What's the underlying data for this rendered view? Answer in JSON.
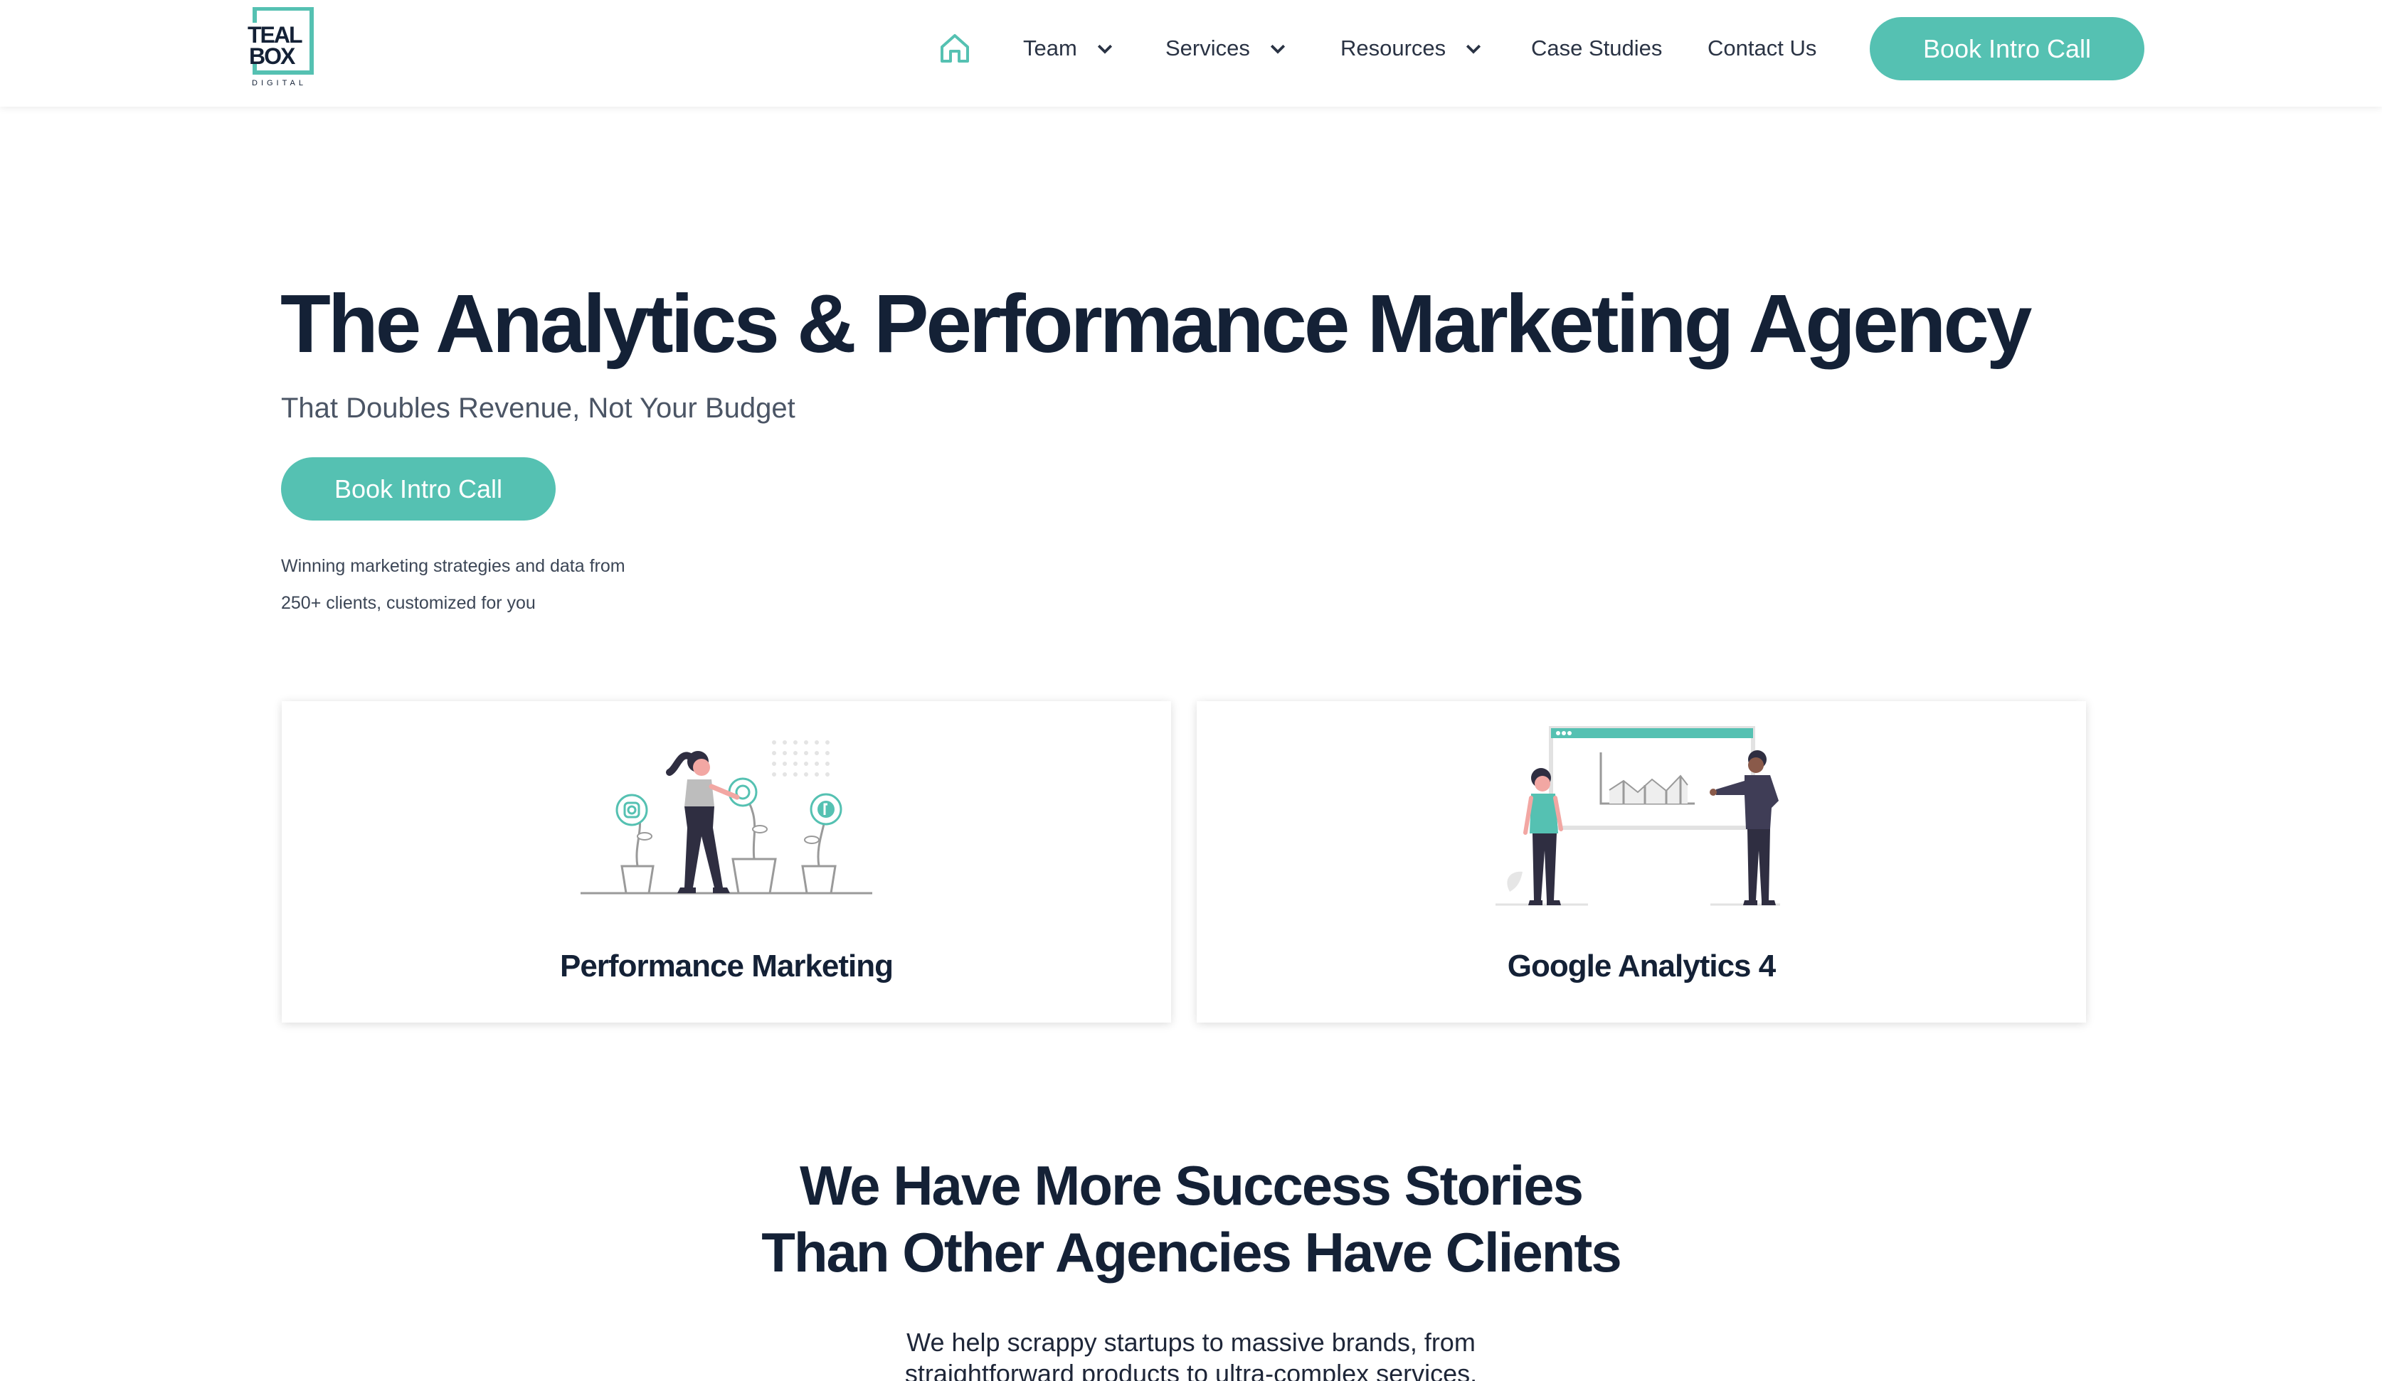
{
  "brand": {
    "logo_line1": "TEAL",
    "logo_line2": "BOX",
    "logo_tagline": "DIGITAL",
    "accent_color": "#55c1b2",
    "heading_color": "#142136"
  },
  "nav": {
    "home_icon": "home-icon",
    "items": [
      {
        "label": "Team",
        "has_dropdown": true
      },
      {
        "label": "Services",
        "has_dropdown": true
      },
      {
        "label": "Resources",
        "has_dropdown": true
      },
      {
        "label": "Case Studies",
        "has_dropdown": false
      },
      {
        "label": "Contact Us",
        "has_dropdown": false
      }
    ],
    "cta_label": "Book Intro Call"
  },
  "hero": {
    "title": "The Analytics & Performance Marketing Agency",
    "subtitle": "That Doubles Revenue, Not Your Budget",
    "cta_label": "Book Intro Call",
    "note_line1": "Winning marketing strategies and data from",
    "note_line2": "250+ clients, customized for you"
  },
  "cards": [
    {
      "title": "Performance Marketing",
      "illustration": "woman-watering-social-plants-illustration"
    },
    {
      "title": "Google Analytics 4",
      "illustration": "people-presenting-analytics-dashboard-illustration"
    }
  ],
  "success": {
    "title_line1": "We Have More Success Stories",
    "title_line2": "Than Other Agencies Have Clients",
    "text_line1": "We help scrappy startups to massive brands, from",
    "text_line2": "straightforward products to ultra-complex services."
  }
}
